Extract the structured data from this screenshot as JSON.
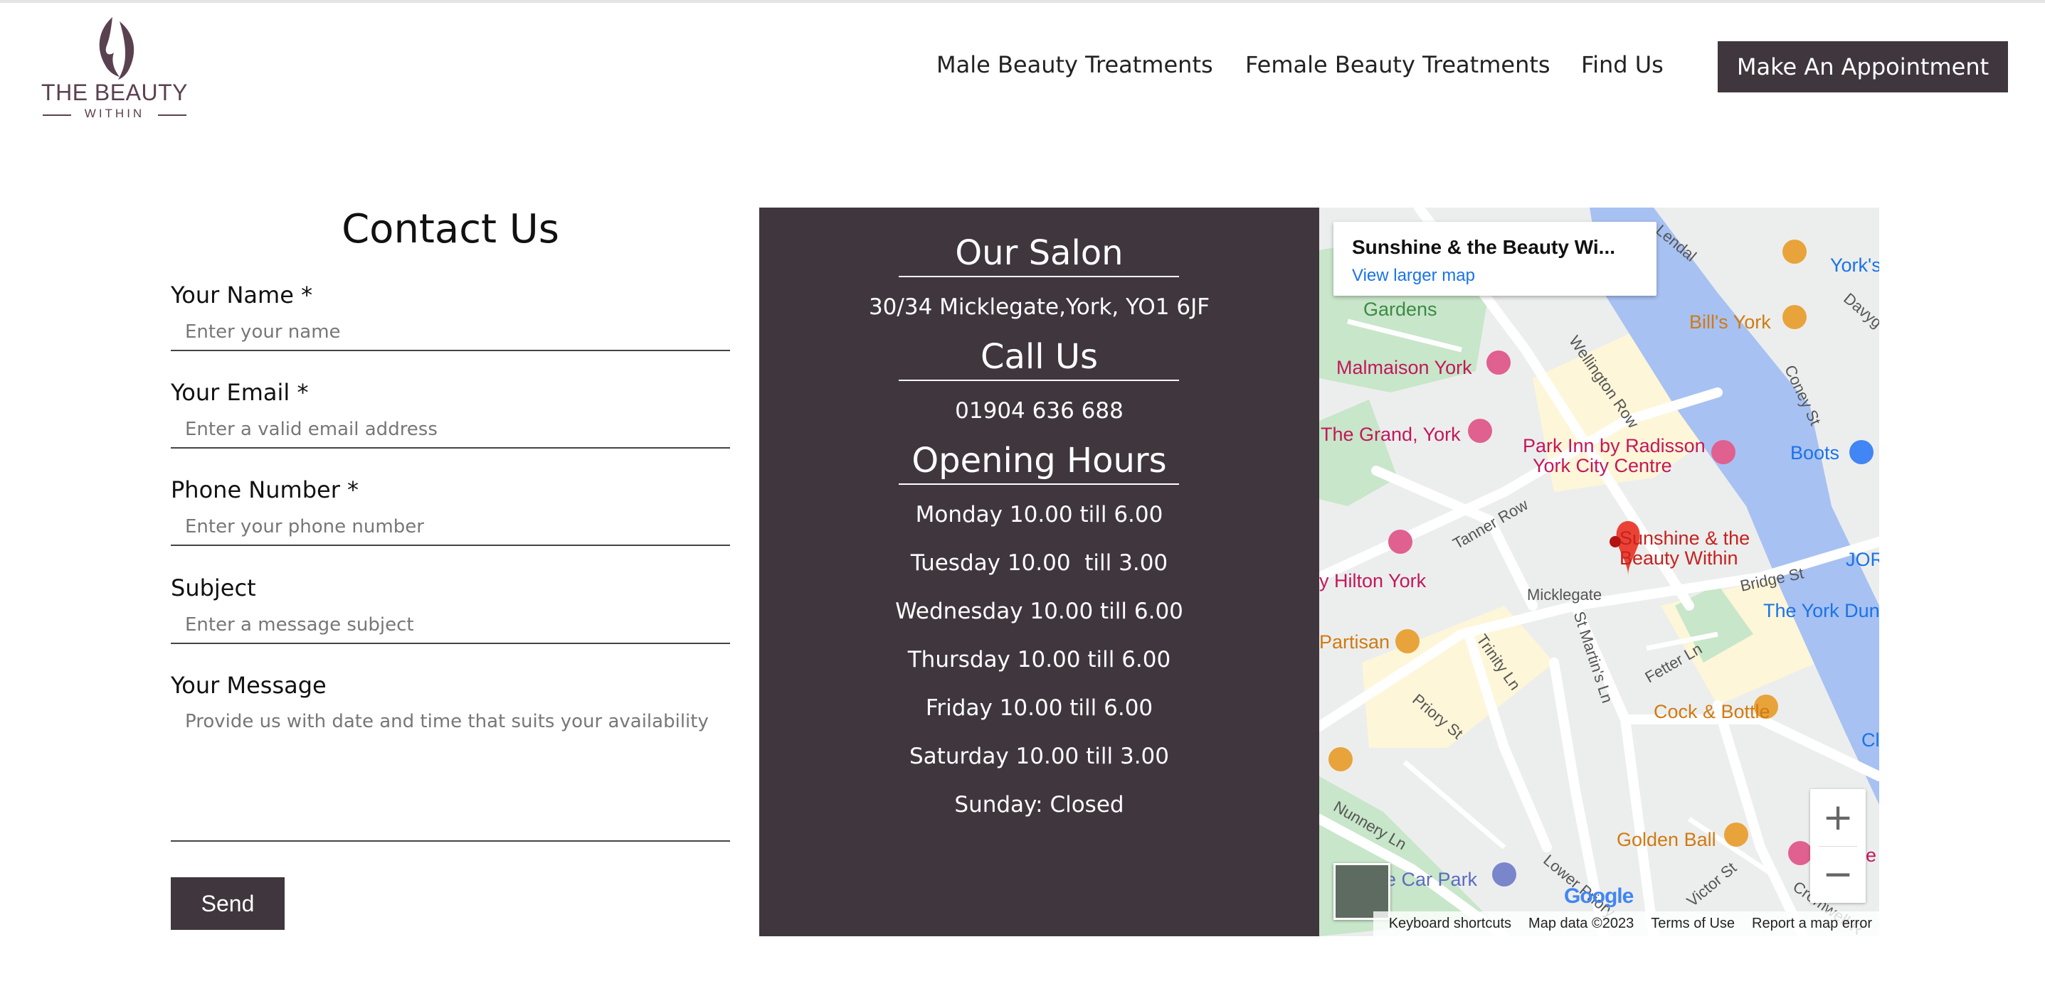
{
  "brand": {
    "name": "THE BEAUTY",
    "tagline": "WITHIN"
  },
  "nav": {
    "items": [
      "Male Beauty Treatments",
      "Female Beauty Treatments",
      "Find Us"
    ],
    "cta": "Make An Appointment"
  },
  "form": {
    "title": "Contact Us",
    "fields": [
      {
        "label": "Your Name *",
        "placeholder": "Enter your name"
      },
      {
        "label": "Your Email *",
        "placeholder": "Enter a valid email address"
      },
      {
        "label": "Phone Number *",
        "placeholder": "Enter your phone number"
      },
      {
        "label": "Subject",
        "placeholder": "Enter a message subject"
      }
    ],
    "message": {
      "label": "Your Message",
      "placeholder": "Provide us with date and time that suits your availability"
    },
    "send": "Send"
  },
  "salon": {
    "title": "Our Salon",
    "address": "30/34 Micklegate,York, YO1 6JF",
    "call_title": "Call Us",
    "phone": "01904 636 688",
    "hours_title": "Opening Hours",
    "hours": [
      "Monday 10.00 till 6.00",
      "Tuesday 10.00  till 3.00",
      "Wednesday 10.00 till 6.00",
      "Thursday 10.00 till 6.00",
      "Friday 10.00 till 6.00",
      "Saturday 10.00 till 3.00",
      "Sunday: Closed"
    ]
  },
  "map": {
    "card_title": "Sunshine & the Beauty Wi...",
    "card_link": "View larger map",
    "places": [
      {
        "text": "Gardens",
        "color": "#3c8a46"
      },
      {
        "text": "Malmaison York",
        "color": "#c2185b"
      },
      {
        "text": "The Grand, York",
        "color": "#c2185b"
      },
      {
        "text": "Park Inn by Radisson",
        "color": "#c2185b"
      },
      {
        "text": "York City Centre",
        "color": "#c2185b"
      },
      {
        "text": "Boots",
        "color": "#1a73e8"
      },
      {
        "text": "Bill's York",
        "color": "#d07a12"
      },
      {
        "text": "York's",
        "color": "#1a73e8"
      },
      {
        "text": "Sunshine & the",
        "color": "#c5221f"
      },
      {
        "text": "Beauty Within",
        "color": "#c5221f"
      },
      {
        "text": "y Hilton York",
        "color": "#c2185b"
      },
      {
        "text": "Partisan",
        "color": "#d07a12"
      },
      {
        "text": "JORV",
        "color": "#1a73e8"
      },
      {
        "text": "The York Dun",
        "color": "#1a73e8"
      },
      {
        "text": "Cock & Bottle",
        "color": "#d07a12"
      },
      {
        "text": "Golden Ball",
        "color": "#d07a12"
      },
      {
        "text": "ne Car Park",
        "color": "#5c6bc0"
      },
      {
        "text": "Cl",
        "color": "#1a73e8"
      },
      {
        "text": "le",
        "color": "#c2185b"
      }
    ],
    "streets": [
      "Lendal",
      "Wellington Row",
      "Coney St",
      "Davyg",
      "Tanner Row",
      "Micklegate",
      "Bridge St",
      "St Martin's Ln",
      "Trinity Ln",
      "Fetter Ln",
      "Priory St",
      "Nunnery Ln",
      "Lower Priory",
      "Victor St",
      "Cromwell R"
    ],
    "zoom_in": "+",
    "zoom_out": "−",
    "google": "Google",
    "attribution": [
      "Keyboard shortcuts",
      "Map data ©2023",
      "Terms of Use",
      "Report a map error"
    ],
    "colors": {
      "water": "#a7c1f2",
      "park": "#c8e6c9",
      "road": "#ffffff",
      "land": "#eceeed",
      "yellow": "#fdf6d8"
    }
  }
}
